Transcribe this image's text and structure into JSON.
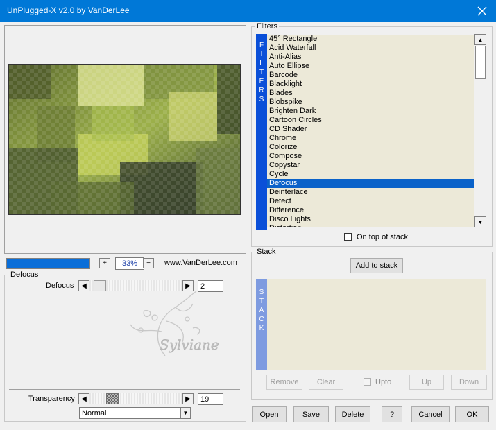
{
  "window": {
    "title": "UnPlugged-X v2.0 by VanDerLee"
  },
  "preview": {
    "zoom": "33%",
    "website": "www.VanDerLee.com",
    "progress": 1.0
  },
  "filters": {
    "group_label": "Filters",
    "tab_label": [
      "F",
      "I",
      "L",
      "T",
      "E",
      "R",
      "S"
    ],
    "items": [
      "45° Rectangle",
      "Acid Waterfall",
      "Anti-Alias",
      "Auto Ellipse",
      "Barcode",
      "Blacklight",
      "Blades",
      "Blobspike",
      "Brighten Dark",
      "Cartoon Circles",
      "CD Shader",
      "Chrome",
      "Colorize",
      "Compose",
      "Copystar",
      "Cycle",
      "Defocus",
      "Deinterlace",
      "Detect",
      "Difference",
      "Disco Lights",
      "Distortion"
    ],
    "selected": "Defocus",
    "on_top_label": "On top of stack",
    "on_top_checked": false
  },
  "stack": {
    "group_label": "Stack",
    "add_label": "Add to stack",
    "tab_label": [
      "S",
      "T",
      "A",
      "C",
      "K"
    ],
    "remove": "Remove",
    "clear": "Clear",
    "upto": "Upto",
    "up": "Up",
    "down": "Down"
  },
  "params": {
    "group_label": "Defocus",
    "defocus_label": "Defocus",
    "defocus_value": "2",
    "transparency_label": "Transparency",
    "transparency_value": "19",
    "blend_mode": "Normal",
    "watermark": "Sylviane"
  },
  "buttons": {
    "open": "Open",
    "save": "Save",
    "delete": "Delete",
    "help": "?",
    "cancel": "Cancel",
    "ok": "OK"
  },
  "colors": {
    "titlebar": "#0078d7",
    "tab_blue": "#0a4fd8",
    "selection": "#0a62c9",
    "list_bg": "#ece9d8"
  }
}
